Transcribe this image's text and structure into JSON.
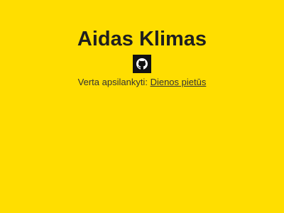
{
  "header": {
    "name": "Aidas Klimas"
  },
  "social": {
    "github_icon": "github-icon",
    "icon_background": "#111111"
  },
  "recommendation": {
    "prefix": "Verta apsilankyti:",
    "link_label": "Dienos pietūs"
  },
  "theme": {
    "background": "#FFDE00",
    "text": "#222222"
  }
}
